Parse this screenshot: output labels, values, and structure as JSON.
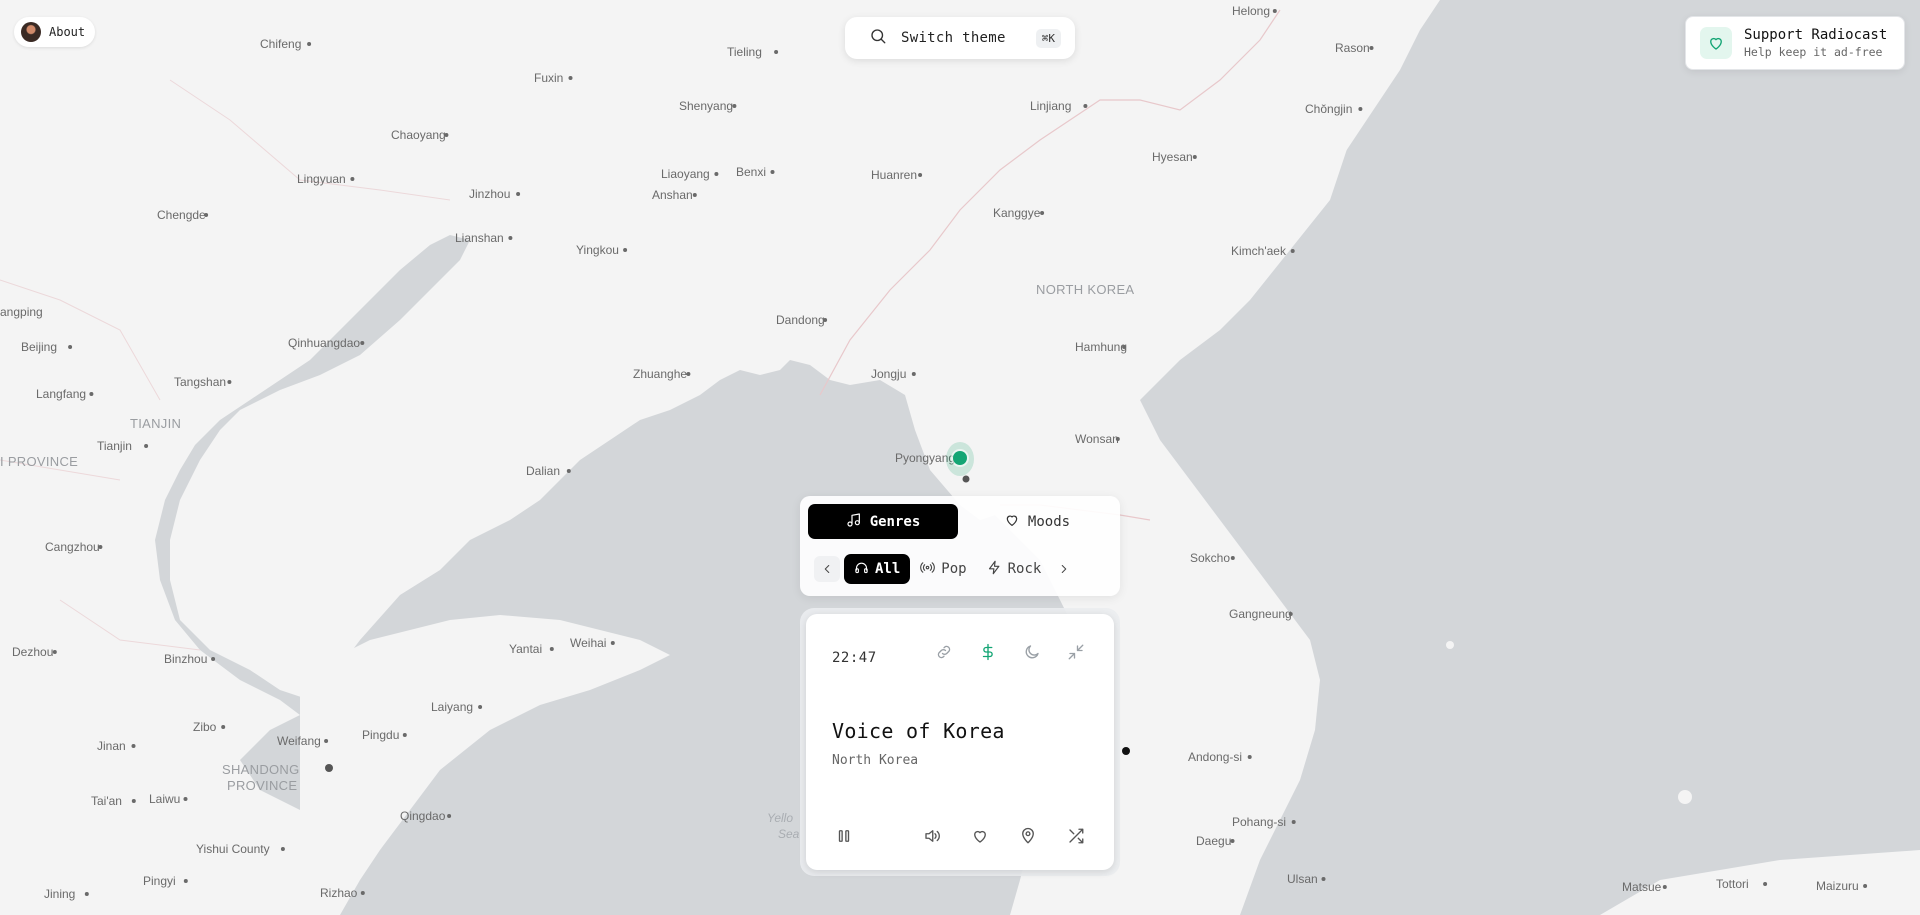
{
  "about": {
    "label": "About"
  },
  "search": {
    "label": "Switch theme",
    "shortcut": "⌘K"
  },
  "support": {
    "title": "Support Radiocast",
    "subtitle": "Help keep it ad-free"
  },
  "categories": {
    "genres_label": "Genres",
    "moods_label": "Moods",
    "chips": [
      "All",
      "Pop",
      "Rock"
    ]
  },
  "player": {
    "time": "22:47",
    "station_name": "Voice of Korea",
    "station_country": "North Korea"
  },
  "colors": {
    "accent": "#13a574",
    "map_land": "#f4f4f4",
    "map_water": "#d3d6d9"
  },
  "map": {
    "cities": [
      "Helong",
      "Rason",
      "Chifeng",
      "Tieling",
      "Fuxin",
      "Shenyang",
      "Linjiang",
      "Chŏngjin",
      "Chaoyang",
      "Hyesan",
      "Lingyuan",
      "Jinzhou",
      "Liaoyang",
      "Anshan",
      "Benxi",
      "Huanren",
      "Chengde",
      "Kanggye",
      "Lianshan",
      "Yingkou",
      "Kimch'aek",
      "Dandong",
      "Beijing",
      "Qinhuangdao",
      "Hamhung",
      "Zhuanghe",
      "Jongju",
      "Langfang",
      "Tangshan",
      "Tianjin",
      "Wonsan",
      "Pyongyang",
      "Dalian",
      "Cangzhou",
      "Sokcho",
      "Gangneung",
      "Dezhou",
      "Binzhou",
      "Weihai",
      "Yantai",
      "Laiyang",
      "Zibo",
      "Jinan",
      "Weifang",
      "Pingdu",
      "Andong-si",
      "Tai'an",
      "Laiwu",
      "Qingdao",
      "Pohang-si",
      "Yishui County",
      "Daegu",
      "Pingyi",
      "Jining",
      "Rizhao",
      "Ulsan",
      "Matsue",
      "Tottori",
      "Maizuru"
    ],
    "regions": [
      "NORTH KOREA",
      "TIANJIN",
      "I PROVINCE",
      "SHANDONG",
      "PROVINCE",
      "angping"
    ],
    "seas": [
      "Yello",
      "Sea"
    ]
  }
}
